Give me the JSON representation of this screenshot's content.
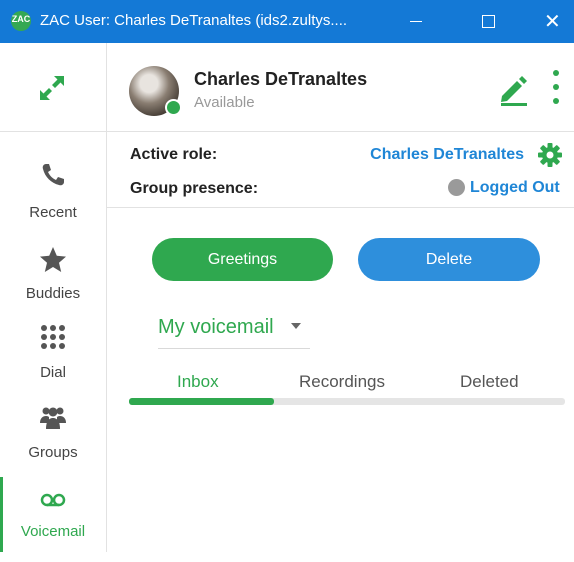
{
  "window": {
    "title": "ZAC User: Charles DeTranaltes (ids2.zultys....",
    "app_icon_label": "ZAC",
    "close_glyph": "✕"
  },
  "nav": {
    "items": [
      {
        "label": "Recent",
        "icon": "phone-icon"
      },
      {
        "label": "Buddies",
        "icon": "star-icon"
      },
      {
        "label": "Dial",
        "icon": "dialpad-icon"
      },
      {
        "label": "Groups",
        "icon": "groups-icon"
      },
      {
        "label": "Voicemail",
        "icon": "voicemail-icon",
        "active": true
      }
    ]
  },
  "user": {
    "name": "Charles DeTranaltes",
    "status": "Available"
  },
  "role": {
    "label": "Active role:",
    "value": "Charles DeTranaltes"
  },
  "group_presence": {
    "label": "Group presence:",
    "value": "Logged Out"
  },
  "actions": {
    "greetings": "Greetings",
    "delete": "Delete"
  },
  "voicemail_box": {
    "selected": "My voicemail"
  },
  "tabs": {
    "items": [
      "Inbox",
      "Recordings",
      "Deleted"
    ],
    "active_index": 0
  },
  "colors": {
    "accent_green": "#2fa84f",
    "accent_blue": "#1f86d6",
    "titlebar": "#1479d6"
  }
}
